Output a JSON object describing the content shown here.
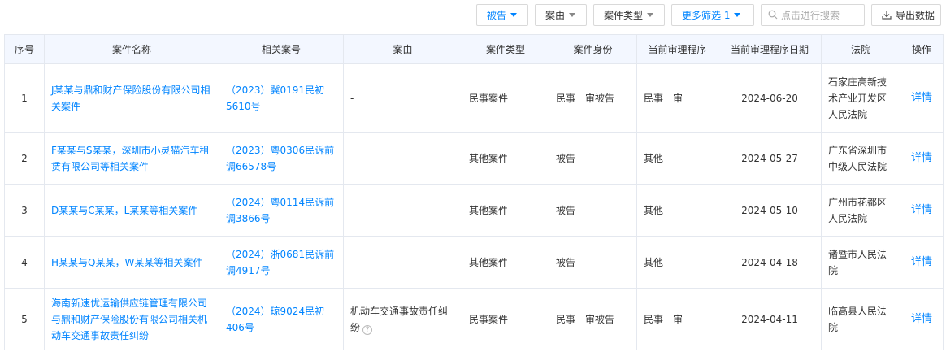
{
  "toolbar": {
    "filter_role": "被告",
    "filter_cause": "案由",
    "filter_type": "案件类型",
    "more_filters": "更多筛选 1",
    "search_placeholder": "点击进行搜索",
    "export_label": "导出数据"
  },
  "table": {
    "headers": [
      "序号",
      "案件名称",
      "相关案号",
      "案由",
      "案件类型",
      "案件身份",
      "当前审理程序",
      "当前审理程序日期",
      "法院",
      "操作"
    ],
    "rows": [
      {
        "seq": "1",
        "name": "J某某与鼎和财产保险股份有限公司相关案件",
        "case_no": "（2023）冀0191民初5610号",
        "cause": "-",
        "type": "民事案件",
        "role": "民事一审被告",
        "procedure": "民事一审",
        "date": "2024-06-20",
        "court": "石家庄高新技术产业开发区人民法院",
        "action": "详情"
      },
      {
        "seq": "2",
        "name": "F某某与S某某，深圳市小灵猫汽车租赁有限公司等相关案件",
        "case_no": "（2023）粤0306民诉前调66578号",
        "cause": "-",
        "type": "其他案件",
        "role": "被告",
        "procedure": "其他",
        "date": "2024-05-27",
        "court": "广东省深圳市中级人民法院",
        "action": "详情"
      },
      {
        "seq": "3",
        "name": "D某某与C某某，L某某等相关案件",
        "case_no": "（2024）粤0114民诉前调3866号",
        "cause": "-",
        "type": "其他案件",
        "role": "被告",
        "procedure": "其他",
        "date": "2024-05-10",
        "court": "广州市花都区人民法院",
        "action": "详情"
      },
      {
        "seq": "4",
        "name": "H某某与Q某某，W某某等相关案件",
        "case_no": "（2024）浙0681民诉前调4917号",
        "cause": "-",
        "type": "其他案件",
        "role": "被告",
        "procedure": "其他",
        "date": "2024-04-18",
        "court": "诸暨市人民法院",
        "action": "详情"
      },
      {
        "seq": "5",
        "name": "海南新速优运输供应链管理有限公司与鼎和财产保险股份有限公司相关机动车交通事故责任纠纷",
        "case_no": "（2024）琼9024民初406号",
        "cause": "机动车交通事故责任纠纷",
        "type": "民事案件",
        "role": "民事一审被告",
        "procedure": "民事一审",
        "date": "2024-04-11",
        "court": "临高县人民法院",
        "action": "详情"
      }
    ]
  },
  "colors": {
    "link": "#0084ff",
    "header_bg": "#f3f7ff",
    "border": "#e4e8ef"
  },
  "icons": {
    "caret": "caret-down-icon",
    "search": "search-icon",
    "export": "download-icon",
    "help": "question-circle-icon"
  }
}
